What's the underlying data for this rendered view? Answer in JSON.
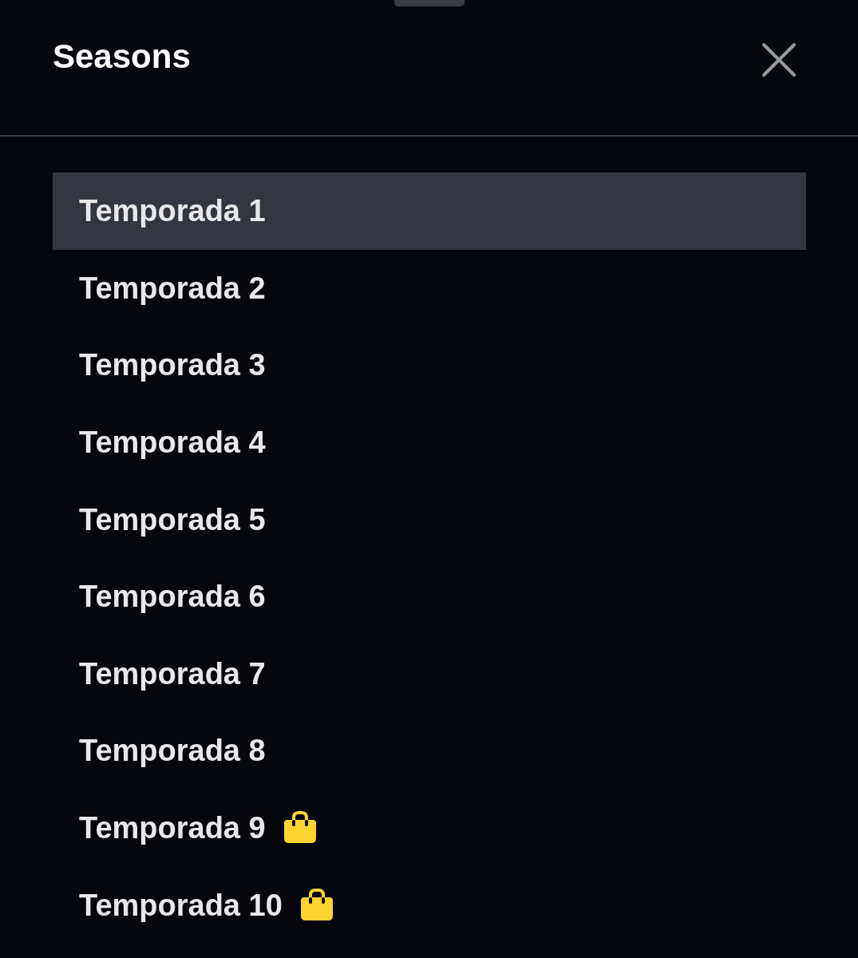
{
  "sheet": {
    "title": "Seasons"
  },
  "seasons": [
    {
      "label": "Temporada 1",
      "selected": true,
      "purchase_required": false
    },
    {
      "label": "Temporada 2",
      "selected": false,
      "purchase_required": false
    },
    {
      "label": "Temporada 3",
      "selected": false,
      "purchase_required": false
    },
    {
      "label": "Temporada 4",
      "selected": false,
      "purchase_required": false
    },
    {
      "label": "Temporada 5",
      "selected": false,
      "purchase_required": false
    },
    {
      "label": "Temporada 6",
      "selected": false,
      "purchase_required": false
    },
    {
      "label": "Temporada 7",
      "selected": false,
      "purchase_required": false
    },
    {
      "label": "Temporada 8",
      "selected": false,
      "purchase_required": false
    },
    {
      "label": "Temporada 9",
      "selected": false,
      "purchase_required": true
    },
    {
      "label": "Temporada 10",
      "selected": false,
      "purchase_required": true
    }
  ]
}
